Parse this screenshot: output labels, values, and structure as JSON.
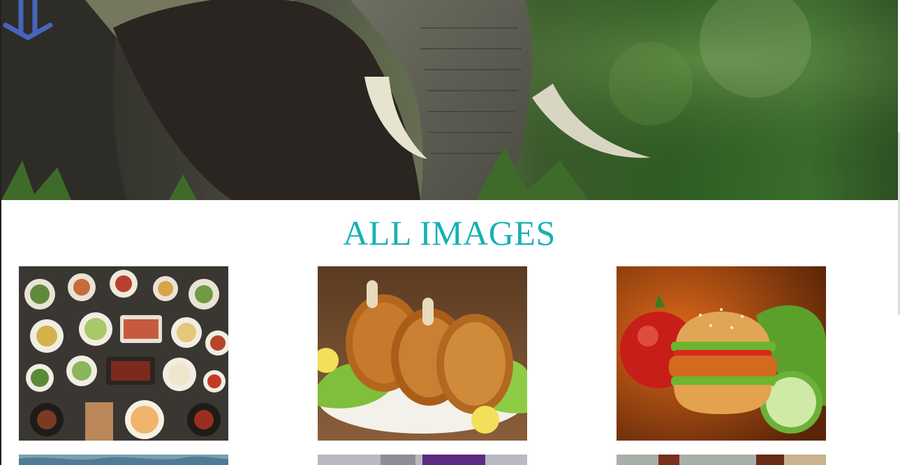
{
  "hero": {
    "image": "elephant-photo",
    "scroll_icon": "double-down-arrow-icon",
    "accent_color": "#4466bb"
  },
  "gallery": {
    "title": "ALL IMAGES",
    "title_color": "#17b0b5",
    "images": [
      {
        "subject": "korean-table-spread"
      },
      {
        "subject": "roast-chicken-legs"
      },
      {
        "subject": "burger-with-vegetables"
      },
      {
        "subject": "sea-water"
      },
      {
        "subject": "purple-item"
      },
      {
        "subject": "drink-glasses"
      }
    ]
  }
}
